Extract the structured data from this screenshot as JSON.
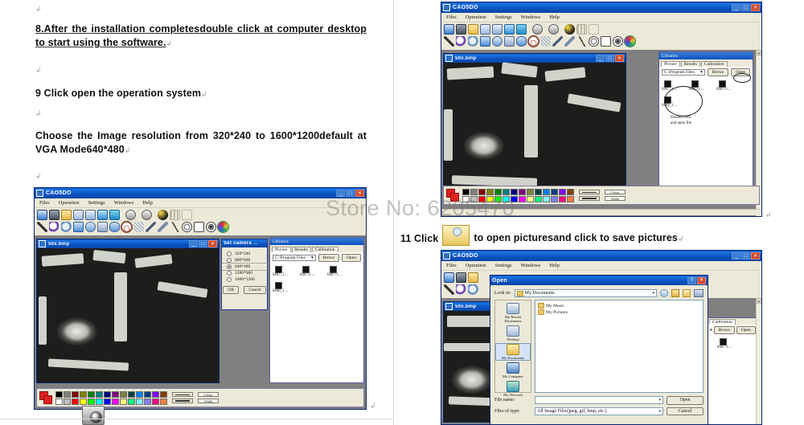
{
  "document": {
    "paragraphs": [
      {
        "id": "p1",
        "text": "8.After  the  installation  completesdouble  click  at  computer desktop to start using the software."
      },
      {
        "id": "p2",
        "text": "9 Click open the operation system"
      },
      {
        "id": "p3",
        "text": "Choose     the     Image     resolution     from     320*240     to 1600*1200default at VGA   Mode640*480"
      }
    ],
    "pilcrow": "↲",
    "caption_11": {
      "prefix": "11 Click",
      "icon": "open-folder-icon",
      "suffix": "to open picturesand click to save pictures"
    }
  },
  "watermark": {
    "text_main": "Store No: 6205470"
  },
  "app": {
    "title": "CAO5DO",
    "menus": [
      "Files",
      "Operation",
      "Settings",
      "Windows",
      "Help"
    ],
    "titlebar_buttons": [
      "minimize",
      "maximize",
      "close"
    ],
    "toolbar_row1": [
      {
        "name": "live-video-icon",
        "cls": "i-monitor"
      },
      {
        "name": "capture-camera-icon",
        "cls": "i-cam"
      },
      {
        "name": "open-folder-icon",
        "cls": "i-folder"
      },
      {
        "name": "new-document-icon",
        "cls": "i-doc1"
      },
      {
        "name": "copy-document-icon",
        "cls": "i-doc2"
      },
      {
        "name": "refresh-icon",
        "cls": "i-refresh"
      },
      {
        "name": "save-icon",
        "cls": "i-save"
      },
      {
        "name": "pause-icon",
        "cls": "i-pause"
      },
      {
        "name": "stop-icon",
        "cls": "i-stop"
      },
      {
        "name": "brightness-ball-icon",
        "cls": "i-ball"
      },
      {
        "name": "grid-icon",
        "cls": "i-grid"
      },
      {
        "name": "text-tool-icon",
        "cls": "i-text"
      }
    ],
    "toolbar_row2": [
      {
        "name": "line-tool-icon",
        "cls": "i-line"
      },
      {
        "name": "zoom-in-icon",
        "cls": "i-mag"
      },
      {
        "name": "zoom-out-icon",
        "cls": "i-mag2"
      },
      {
        "name": "rectangle-tool-icon",
        "cls": "i-rect"
      },
      {
        "name": "circle-tool-icon",
        "cls": "i-circ"
      },
      {
        "name": "polyline-tool-icon",
        "cls": "i-wave"
      },
      {
        "name": "ellipse-tool-icon",
        "cls": "i-ellip"
      },
      {
        "name": "arc-measure-icon",
        "cls": "i-arc",
        "selected": "red"
      },
      {
        "name": "dotted-line-icon",
        "cls": "i-dotline"
      },
      {
        "name": "diagonal-measure-icon",
        "cls": "i-slash"
      },
      {
        "name": "parallel-measure-icon",
        "cls": "i-slash2"
      },
      {
        "name": "angle-measure-icon",
        "cls": "i-angle"
      },
      {
        "name": "contrast-icon",
        "cls": "i-c1"
      },
      {
        "name": "split-view-icon",
        "cls": "i-c2"
      },
      {
        "name": "invert-icon",
        "cls": "i-c3"
      },
      {
        "name": "color-picker-icon",
        "cls": "i-color",
        "selected": "green"
      }
    ],
    "image_window": {
      "title": "50x.bmp"
    },
    "set_camera_dialog": {
      "title": "Set  camera ...",
      "options": [
        "320*240",
        "800*600",
        "640*480",
        "1280*960",
        "1600*1200"
      ],
      "selected_index": 2,
      "ok_label": "OK",
      "cancel_label": "Cancel"
    },
    "libraries": {
      "title": "Libraries",
      "tabs": [
        "Picture",
        "Results",
        "Calibration"
      ],
      "active_tab": "Picture",
      "path": "C:\\Program Files",
      "browse_label": "Brows",
      "open_label": "Open",
      "thumbnails": [
        "0407_1 ...",
        "0407-2 ...",
        "0407-3 ...",
        "0408_1 ..."
      ],
      "note_line1": "Double click",
      "note_line2": "and open file"
    },
    "palette": {
      "row1": [
        "#000000",
        "#808080",
        "#800000",
        "#808000",
        "#008000",
        "#008080",
        "#000080",
        "#800080",
        "#808040",
        "#004040",
        "#0080ff",
        "#004080",
        "#8000ff",
        "#804000"
      ],
      "row2": [
        "#ffffff",
        "#c0c0c0",
        "#ff0000",
        "#ffff00",
        "#00ff00",
        "#00ffff",
        "#0000ff",
        "#ff00ff",
        "#ffff80",
        "#00ff80",
        "#80ffff",
        "#8080ff",
        "#ff0080",
        "#ff8040"
      ],
      "current_color": "#ff0000",
      "field_labels": [
        "Colour",
        "Width"
      ]
    }
  },
  "open_dialog": {
    "title": "Open",
    "look_in_label": "Look in:",
    "look_in_value": "My Documents",
    "toolbar_icons": [
      "back-icon",
      "up-one-level-icon",
      "new-folder-icon",
      "views-icon"
    ],
    "places": [
      {
        "name": "my-recent-documents",
        "label": "My Recent\nDocuments"
      },
      {
        "name": "desktop",
        "label": "Desktop"
      },
      {
        "name": "my-documents",
        "label": "My Documents"
      },
      {
        "name": "my-computer",
        "label": "My Computer"
      },
      {
        "name": "my-network",
        "label": "My Network"
      }
    ],
    "active_place": "My Documents",
    "files": [
      "My Music",
      "My Pictures"
    ],
    "file_name_label": "File name:",
    "file_name_value": "",
    "files_of_type_label": "Files of type:",
    "files_of_type_value": "All Image Files(jpeg, gif, bmp, etc.)",
    "open_label": "Open",
    "cancel_label": "Cancel",
    "help_button": "?",
    "close_button": "✕"
  }
}
